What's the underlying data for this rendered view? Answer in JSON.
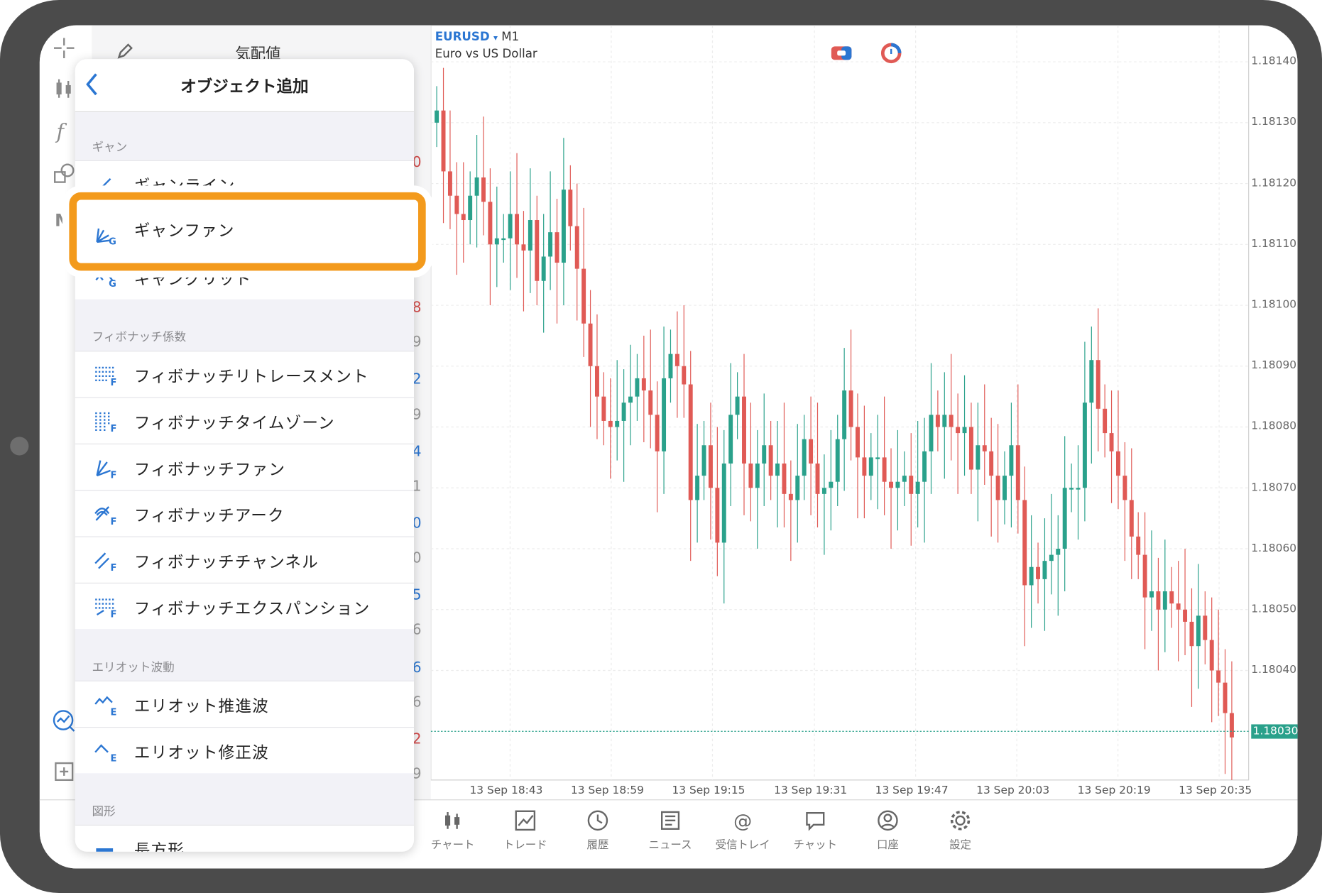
{
  "toolbar": {
    "icons": [
      "crosshair-icon",
      "candlestick-icon",
      "function-icon",
      "shapes-icon",
      "m-icon",
      "indicator-icon",
      "add-window-icon"
    ]
  },
  "background": {
    "quotes_title": "気配値",
    "quote_fragments": [
      "0",
      "8",
      "9",
      "2",
      "9",
      "4",
      "1",
      "0",
      "0",
      "5",
      "6",
      "6",
      "6",
      "2",
      "9"
    ]
  },
  "panel": {
    "title": "オブジェクト追加",
    "sections": [
      {
        "label": "ギャン",
        "items": [
          "ギャンライン",
          "ギャンファン",
          "ギャングリッド"
        ]
      },
      {
        "label": "フィボナッチ係数",
        "items": [
          "フィボナッチリトレースメント",
          "フィボナッチタイムゾーン",
          "フィボナッチファン",
          "フィボナッチアーク",
          "フィボナッチチャンネル",
          "フィボナッチエクスパンション"
        ]
      },
      {
        "label": "エリオット波動",
        "items": [
          "エリオット推進波",
          "エリオット修正波"
        ]
      },
      {
        "label": "図形",
        "items": [
          "長方形"
        ]
      }
    ],
    "highlighted": "ギャンファン",
    "highlight_color": "#f39a1c"
  },
  "chart": {
    "symbol": "EURUSD",
    "dropdown": "▾",
    "timeframe": "M1",
    "description": "Euro vs US Dollar",
    "price_labels": [
      "1.18140",
      "1.18130",
      "1.18120",
      "1.18110",
      "1.18100",
      "1.18090",
      "1.18080",
      "1.18070",
      "1.18060",
      "1.18050",
      "1.18040"
    ],
    "current_price": "1.18030",
    "time_labels": [
      "13 Sep 18:43",
      "13 Sep 18:59",
      "13 Sep 19:15",
      "13 Sep 19:31",
      "13 Sep 19:47",
      "13 Sep 20:03",
      "13 Sep 20:19",
      "13 Sep 20:35"
    ],
    "up_color": "#2aa18b",
    "down_color": "#e05a55"
  },
  "chart_data": {
    "type": "candlestick",
    "symbol": "EURUSD",
    "timeframe": "M1",
    "ylim": [
      1.18022,
      1.18146
    ],
    "closes": [
      1.18132,
      1.18122,
      1.18118,
      1.18115,
      1.18114,
      1.18118,
      1.18121,
      1.18117,
      1.1811,
      1.18111,
      1.18111,
      1.18115,
      1.1811,
      1.18109,
      1.18114,
      1.18104,
      1.18108,
      1.18112,
      1.18107,
      1.18119,
      1.18113,
      1.18106,
      1.18097,
      1.1809,
      1.18085,
      1.18081,
      1.1808,
      1.18081,
      1.18084,
      1.18085,
      1.18088,
      1.18086,
      1.18082,
      1.18076,
      1.18088,
      1.18092,
      1.1809,
      1.18087,
      1.18068,
      1.18072,
      1.18077,
      1.1807,
      1.18061,
      1.18074,
      1.18082,
      1.18085,
      1.18074,
      1.1807,
      1.18074,
      1.18077,
      1.18072,
      1.18074,
      1.18069,
      1.18068,
      1.18072,
      1.18078,
      1.18074,
      1.18069,
      1.1807,
      1.18071,
      1.18078,
      1.18086,
      1.1808,
      1.18075,
      1.18072,
      1.18075,
      1.18075,
      1.18071,
      1.1807,
      1.18071,
      1.18072,
      1.18069,
      1.18071,
      1.18076,
      1.18082,
      1.1808,
      1.18082,
      1.1808,
      1.18079,
      1.1808,
      1.18073,
      1.18077,
      1.18076,
      1.18072,
      1.18068,
      1.18072,
      1.18077,
      1.18068,
      1.18054,
      1.18057,
      1.18055,
      1.18058,
      1.18059,
      1.1806,
      1.1807,
      1.1807,
      1.1807,
      1.18084,
      1.18091,
      1.18083,
      1.18079,
      1.18076,
      1.18072,
      1.18068,
      1.18062,
      1.18059,
      1.18052,
      1.18053,
      1.1805,
      1.18053,
      1.18051,
      1.1805,
      1.18048,
      1.18044,
      1.18049,
      1.18045,
      1.1804,
      1.18038,
      1.18033,
      1.18029
    ]
  }
}
